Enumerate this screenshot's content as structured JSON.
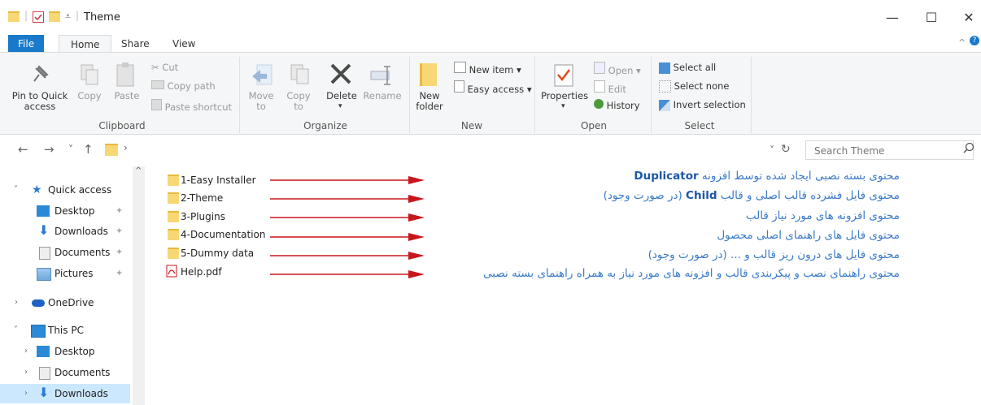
{
  "window": {
    "title": "Theme",
    "minimize": "—",
    "maximize": "☐",
    "close": "✕",
    "help_chevron": "^"
  },
  "tabs": [
    {
      "label": "File"
    },
    {
      "label": "Home"
    },
    {
      "label": "Share"
    },
    {
      "label": "View"
    }
  ],
  "ribbon": {
    "clipboard": {
      "label": "Clipboard",
      "pin": "Pin to Quick\naccess",
      "copy": "Copy",
      "paste": "Paste",
      "cut": "Cut",
      "copy_path": "Copy path",
      "paste_shortcut": "Paste shortcut"
    },
    "organize": {
      "label": "Organize",
      "move_to": "Move\nto",
      "copy_to": "Copy\nto",
      "delete": "Delete",
      "rename": "Rename"
    },
    "new": {
      "label": "New",
      "new_folder": "New\nfolder",
      "new_item": "New item",
      "easy_access": "Easy access"
    },
    "open": {
      "label": "Open",
      "properties": "Properties",
      "open": "Open",
      "edit": "Edit",
      "history": "History"
    },
    "select": {
      "label": "Select",
      "select_all": "Select all",
      "select_none": "Select none",
      "invert": "Invert selection"
    }
  },
  "address": {
    "back": "←",
    "forward": "→",
    "recent": "˅",
    "up": "↑",
    "sep": "›",
    "refresh": "↻",
    "dropdown": "˅"
  },
  "search": {
    "placeholder": "Search Theme"
  },
  "sidebar": {
    "quick_access": "Quick access",
    "items_quick": [
      "Desktop",
      "Downloads",
      "Documents",
      "Pictures"
    ],
    "onedrive": "OneDrive",
    "this_pc": "This PC",
    "items_pc": [
      "Desktop",
      "Documents",
      "Downloads"
    ]
  },
  "files": [
    "1-Easy Installer",
    "2-Theme",
    "3-Plugins",
    "4-Documentation",
    "5-Dummy data",
    "Help.pdf"
  ],
  "notes": [
    {
      "pre": "محتوی بسته نصبی ایجاد شده توسط افزونه ",
      "bold": "Duplicator",
      "post": ""
    },
    {
      "pre": "محتوی فایل فشرده قالب اصلی و قالب ",
      "bold": "Child",
      "post": " (در صورت وجود)"
    },
    {
      "pre": "محتوی افزونه های مورد نیاز قالب",
      "bold": "",
      "post": ""
    },
    {
      "pre": "محتوی فایل های راهنمای اصلی محصول",
      "bold": "",
      "post": ""
    },
    {
      "pre": "محتوی فایل های درون ریز قالب و ... (در صورت وجود)",
      "bold": "",
      "post": ""
    },
    {
      "pre": "محتوی راهنمای نصب و پیکربندی قالب و افزونه های مورد نیاز به همراه راهنمای بسته نصبی",
      "bold": "",
      "post": ""
    }
  ],
  "colors": {
    "file_tab": "#1979ca",
    "arrow": "#c8161d",
    "note": "#3a7bc8",
    "folder": "#f8d775",
    "selected": "#cce8ff"
  }
}
